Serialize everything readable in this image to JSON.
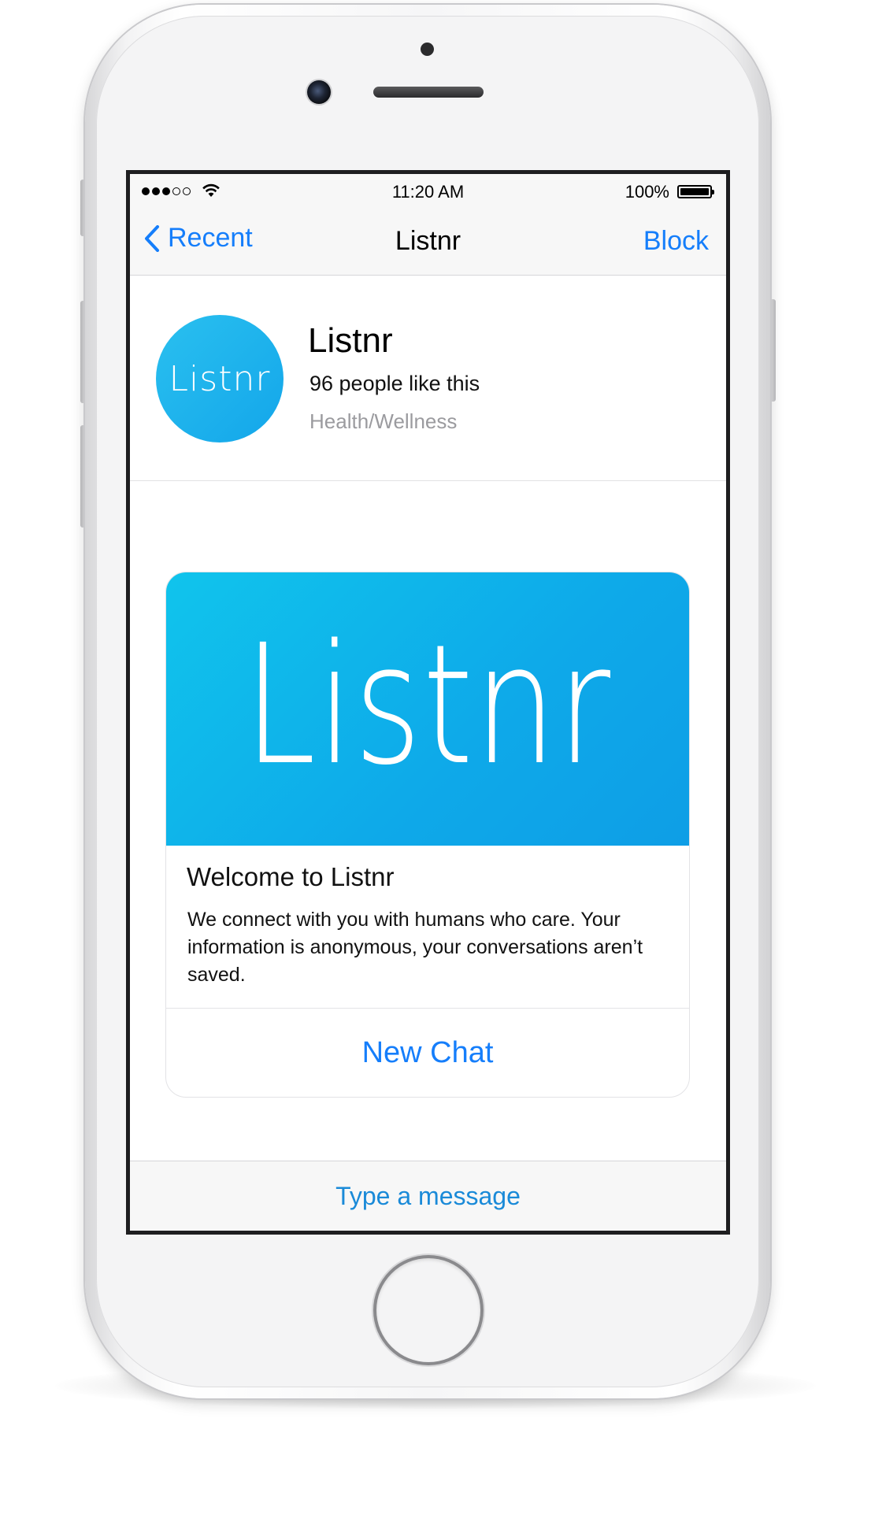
{
  "status_bar": {
    "signal_bars_on": 3,
    "signal_bars_total": 5,
    "time": "11:20 AM",
    "battery_percent": "100%"
  },
  "nav": {
    "back_label": "Recent",
    "title": "Listnr",
    "action_label": "Block"
  },
  "profile": {
    "avatar_text": "Listnr",
    "name": "Listnr",
    "likes": "96 people like this",
    "category": "Health/Wellness"
  },
  "card": {
    "hero_text": "Listnr",
    "title": "Welcome to Listnr",
    "body": "We connect with you with humans who care. Your information is anonymous, your conversations aren’t saved.",
    "action_label": "New Chat"
  },
  "composer": {
    "placeholder": "Type a message"
  },
  "colors": {
    "accent": "#157efb",
    "brand": "#13a6ea",
    "secondary_text": "#9b9b9f"
  },
  "icons": [
    "signal-icon",
    "wifi-icon",
    "battery-icon",
    "chevron-left-icon"
  ]
}
